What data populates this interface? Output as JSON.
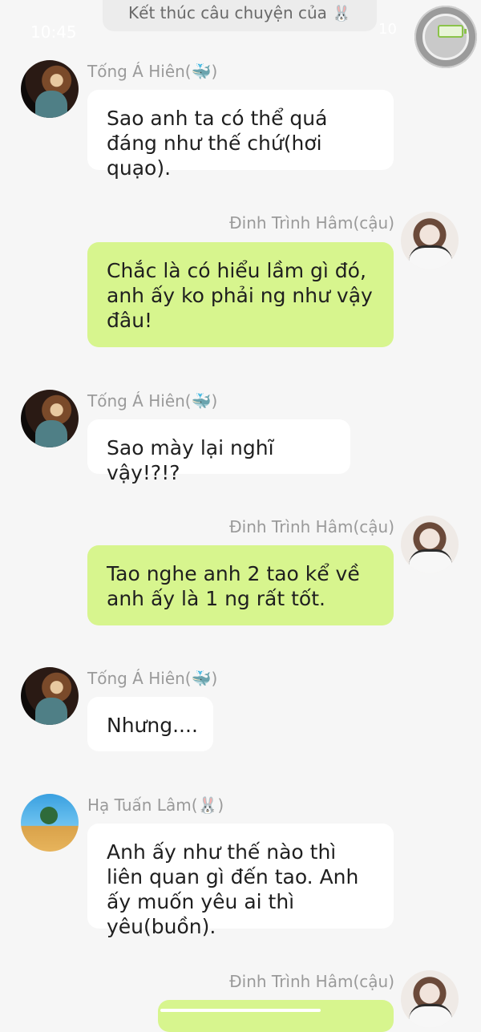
{
  "header": {
    "story_banner": "Kết thúc câu chuyện của",
    "story_banner_emoji": "🐰",
    "status_time": "10:45",
    "status_battery": "10"
  },
  "messages": [
    {
      "sender": "Tống Á Hiên",
      "emoji": "🐳",
      "side": "left",
      "text": "Sao anh ta có thể quá đáng như thế chứ(hơi quạo)."
    },
    {
      "sender": "Đinh Trình Hâm(cậu)",
      "side": "right",
      "text": "Chắc là có hiểu lầm gì đó, anh ấy ko phải ng như vậy đâu!"
    },
    {
      "sender": "Tống Á Hiên",
      "emoji": "🐳",
      "side": "left",
      "text": "Sao mày lại nghĩ vậy!?!?"
    },
    {
      "sender": "Đinh Trình Hâm(cậu)",
      "side": "right",
      "text": "Tao nghe anh 2 tao kể về anh ấy là 1 ng rất tốt."
    },
    {
      "sender": "Tống Á Hiên",
      "emoji": "🐳",
      "side": "left",
      "text": "Nhưng...."
    },
    {
      "sender": "Hạ Tuấn Lâm",
      "emoji": "🐰",
      "side": "left",
      "text": "Anh ấy như thế nào thì liên quan gì đến tao. Anh ấy muốn yêu ai thì yêu(buồn)."
    },
    {
      "sender": "Đinh Trình Hâm(cậu)",
      "side": "right",
      "text": ""
    }
  ],
  "colors": {
    "green_bubble": "#d7f58e",
    "white_bubble": "#ffffff",
    "background": "#f6f6f6"
  }
}
